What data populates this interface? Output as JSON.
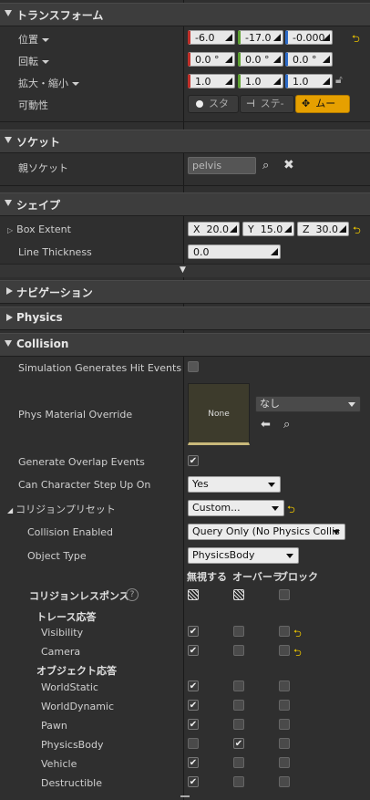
{
  "transform": {
    "title": "トランスフォーム",
    "location_label": "位置",
    "location": [
      "-6.0",
      "-17.0",
      "-0.000"
    ],
    "rotation_label": "回転",
    "rotation": [
      "0.0 °",
      "0.0 °",
      "0.0 °"
    ],
    "scale_label": "拡大・縮小",
    "scale": [
      "1.0",
      "1.0",
      "1.0"
    ],
    "mobility_label": "可動性",
    "mobility_options": [
      "スタ",
      "ステ-",
      "ムー"
    ]
  },
  "socket": {
    "title": "ソケット",
    "parent_label": "親ソケット",
    "parent_value": "pelvis"
  },
  "shape": {
    "title": "シェイプ",
    "box_extent_label": "Box Extent",
    "box_x_prefix": "X",
    "box_x": "20.0",
    "box_y_prefix": "Y",
    "box_y": "15.0",
    "box_z_prefix": "Z",
    "box_z": "30.0",
    "line_thickness_label": "Line Thickness",
    "line_thickness": "0.0"
  },
  "navigation": {
    "title": "ナビゲーション"
  },
  "physics": {
    "title": "Physics"
  },
  "collision": {
    "title": "Collision",
    "sim_hit_label": "Simulation Generates Hit Events",
    "phys_mat_label": "Phys Material Override",
    "phys_mat_thumb": "None",
    "phys_mat_value": "なし",
    "overlap_label": "Generate Overlap Events",
    "step_up_label": "Can Character Step Up On",
    "step_up_value": "Yes",
    "preset_label": "コリジョンプリセット",
    "preset_value": "Custom...",
    "enabled_label": "Collision Enabled",
    "enabled_value": "Query Only (No Physics Collis",
    "object_type_label": "Object Type",
    "object_type_value": "PhysicsBody",
    "col_ignore": "無視する",
    "col_overlap": "オーバーラップ",
    "col_block": "ブロック",
    "response_label": "コリジョンレスポンス",
    "trace_header": "トレース応答",
    "object_header": "オブジェクト応答",
    "trace_rows": [
      {
        "name": "Visibility"
      },
      {
        "name": "Camera"
      }
    ],
    "object_rows": [
      {
        "name": "WorldStatic"
      },
      {
        "name": "WorldDynamic"
      },
      {
        "name": "Pawn"
      },
      {
        "name": "PhysicsBody"
      },
      {
        "name": "Vehicle"
      },
      {
        "name": "Destructible"
      }
    ]
  },
  "colors": {
    "accent": "#e6c000",
    "x_axis": "#c0302a",
    "y_axis": "#5fa233",
    "z_axis": "#2c6bc8",
    "mobility_active": "#e6a000"
  }
}
